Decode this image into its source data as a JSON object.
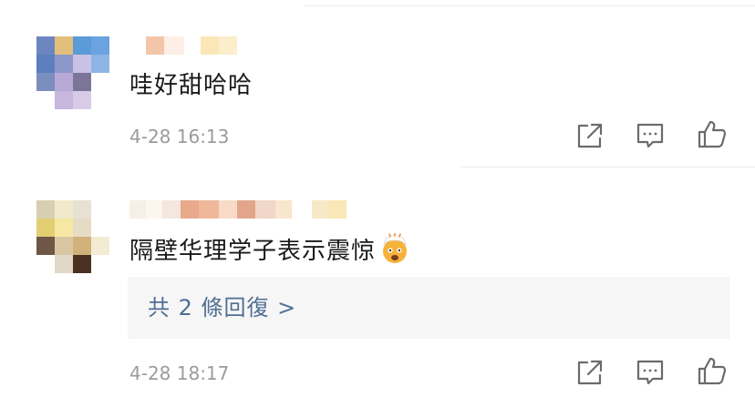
{
  "comments": [
    {
      "text": "哇好甜哈哈",
      "time": "4-28 16:13"
    },
    {
      "text": "隔壁华理学子表示震惊",
      "emoji": "exploding-head-emoji",
      "time": "4-28 18:17",
      "replies_label": "共 2 條回復 >"
    }
  ],
  "icons": {
    "share": "share-icon",
    "comment": "comment-icon",
    "like": "thumbs-up-icon"
  },
  "colors": {
    "text": "#1a1a1a",
    "timestamp": "#9b9b9b",
    "link": "#4f6f94",
    "reply_box": "#f6f6f6",
    "icon": "#6b6b6b"
  }
}
